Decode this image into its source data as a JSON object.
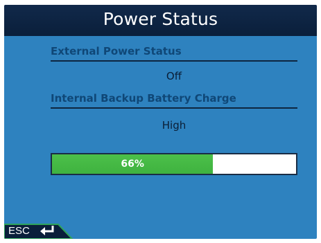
{
  "title": "Power Status",
  "external_power": {
    "label": "External Power Status",
    "value": "Off"
  },
  "backup_battery": {
    "label": "Internal Backup Battery Charge",
    "value": "High",
    "charge_percent": 66,
    "charge_text": "66%"
  },
  "footer": {
    "esc_label": "ESC",
    "esc_icon": "return-arrow-icon"
  },
  "colors": {
    "screen_background": "#2e82bf",
    "title_bar": "#0a1f3b",
    "progress_fill": "#3fb23f",
    "esc_tab": "#0a1f3b",
    "esc_tab_border": "#2fa35a"
  }
}
